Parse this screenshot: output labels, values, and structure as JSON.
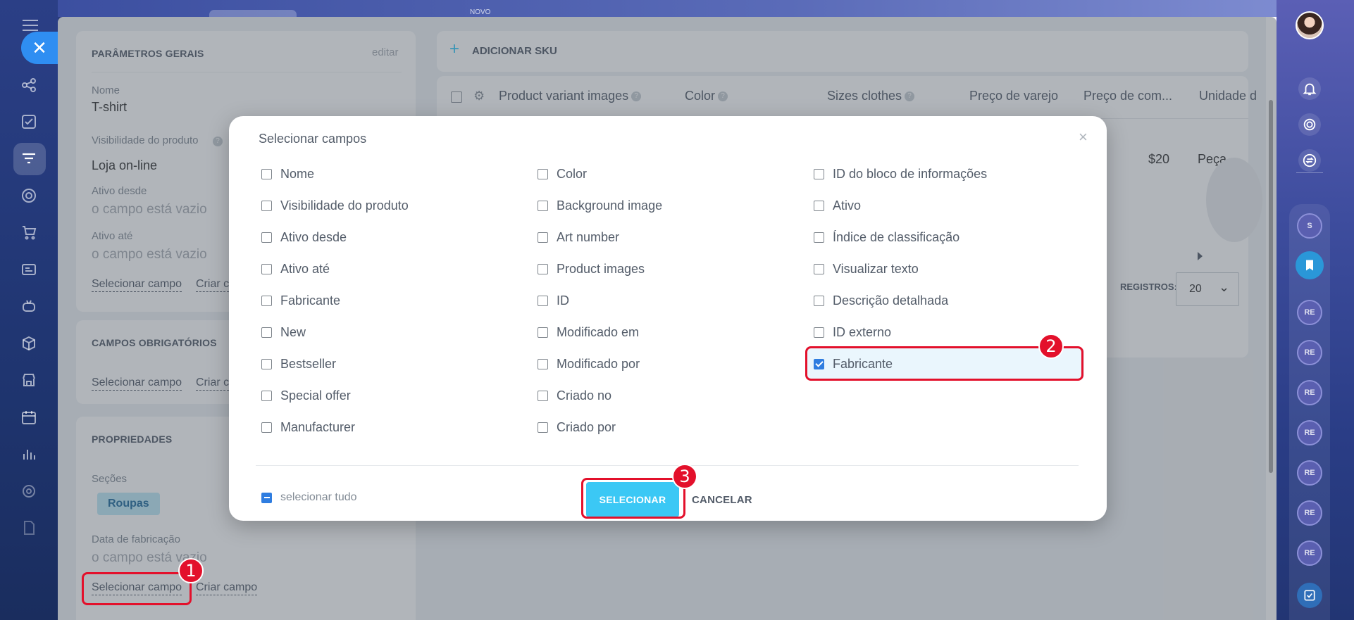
{
  "top_bar": {
    "novo_label": "NOVO"
  },
  "general_params": {
    "title": "PARÂMETROS GERAIS",
    "edit_label": "editar",
    "fields": [
      {
        "label": "Nome",
        "value": "T-shirt"
      },
      {
        "label": "Visibilidade do produto",
        "value": "Loja on-line"
      },
      {
        "label": "Ativo desde",
        "value": "o campo está vazio"
      },
      {
        "label": "Ativo até",
        "value": "o campo está vazio"
      }
    ],
    "select_field_link": "Selecionar campo",
    "create_field_link": "Criar c"
  },
  "required_fields": {
    "title": "CAMPOS OBRIGATÓRIOS",
    "select_field_link": "Selecionar campo",
    "create_field_link": "Criar c"
  },
  "properties": {
    "title": "PROPRIEDADES",
    "sections_label": "Seções",
    "sections_tag": "Roupas",
    "mfg_date_label": "Data de fabricação",
    "mfg_date_value": "o campo está vazio",
    "select_field_link": "Selecionar campo",
    "create_field_link": "Criar campo"
  },
  "sku_panel": {
    "add_sku_label": "ADICIONAR SKU",
    "columns": [
      "Product variant images",
      "Color",
      "Sizes clothes",
      "Preço de varejo",
      "Preço de com...",
      "Unidade d"
    ],
    "row_price": "$20",
    "row_unit": "Peça",
    "records_label": "REGISTROS:",
    "records_value": "20"
  },
  "modal": {
    "title": "Selecionar campos",
    "close_glyph": "×",
    "columns": [
      [
        {
          "label": "Nome",
          "checked": false
        },
        {
          "label": "Visibilidade do produto",
          "checked": false
        },
        {
          "label": "Ativo desde",
          "checked": false
        },
        {
          "label": "Ativo até",
          "checked": false
        },
        {
          "label": "Fabricante",
          "checked": false
        },
        {
          "label": "New",
          "checked": false
        },
        {
          "label": "Bestseller",
          "checked": false
        },
        {
          "label": "Special offer",
          "checked": false
        },
        {
          "label": "Manufacturer",
          "checked": false
        }
      ],
      [
        {
          "label": "Color",
          "checked": false
        },
        {
          "label": "Background image",
          "checked": false
        },
        {
          "label": "Art number",
          "checked": false
        },
        {
          "label": "Product images",
          "checked": false
        },
        {
          "label": "ID",
          "checked": false
        },
        {
          "label": "Modificado em",
          "checked": false
        },
        {
          "label": "Modificado por",
          "checked": false
        },
        {
          "label": "Criado no",
          "checked": false
        },
        {
          "label": "Criado por",
          "checked": false
        }
      ],
      [
        {
          "label": "ID do bloco de informações",
          "checked": false
        },
        {
          "label": "Ativo",
          "checked": false
        },
        {
          "label": "Índice de classificação",
          "checked": false
        },
        {
          "label": "Visualizar texto",
          "checked": false
        },
        {
          "label": "Descrição detalhada",
          "checked": false
        },
        {
          "label": "ID externo",
          "checked": false
        },
        {
          "label": "Fabricante",
          "checked": true
        }
      ]
    ],
    "select_all_label": "selecionar tudo",
    "select_button": "SELECIONAR",
    "cancel_button": "CANCELAR"
  },
  "right_rail": {
    "bubbles": [
      "S",
      "RE",
      "RE",
      "RE",
      "RE",
      "RE",
      "RE",
      "RE"
    ]
  },
  "annotations": [
    "1",
    "2",
    "3"
  ],
  "colors": {
    "accent_blue": "#3bc8f5",
    "checkbox_blue": "#2f7de0",
    "callout_red": "#e3102b",
    "sidebar_blue": "#2b3f86"
  }
}
